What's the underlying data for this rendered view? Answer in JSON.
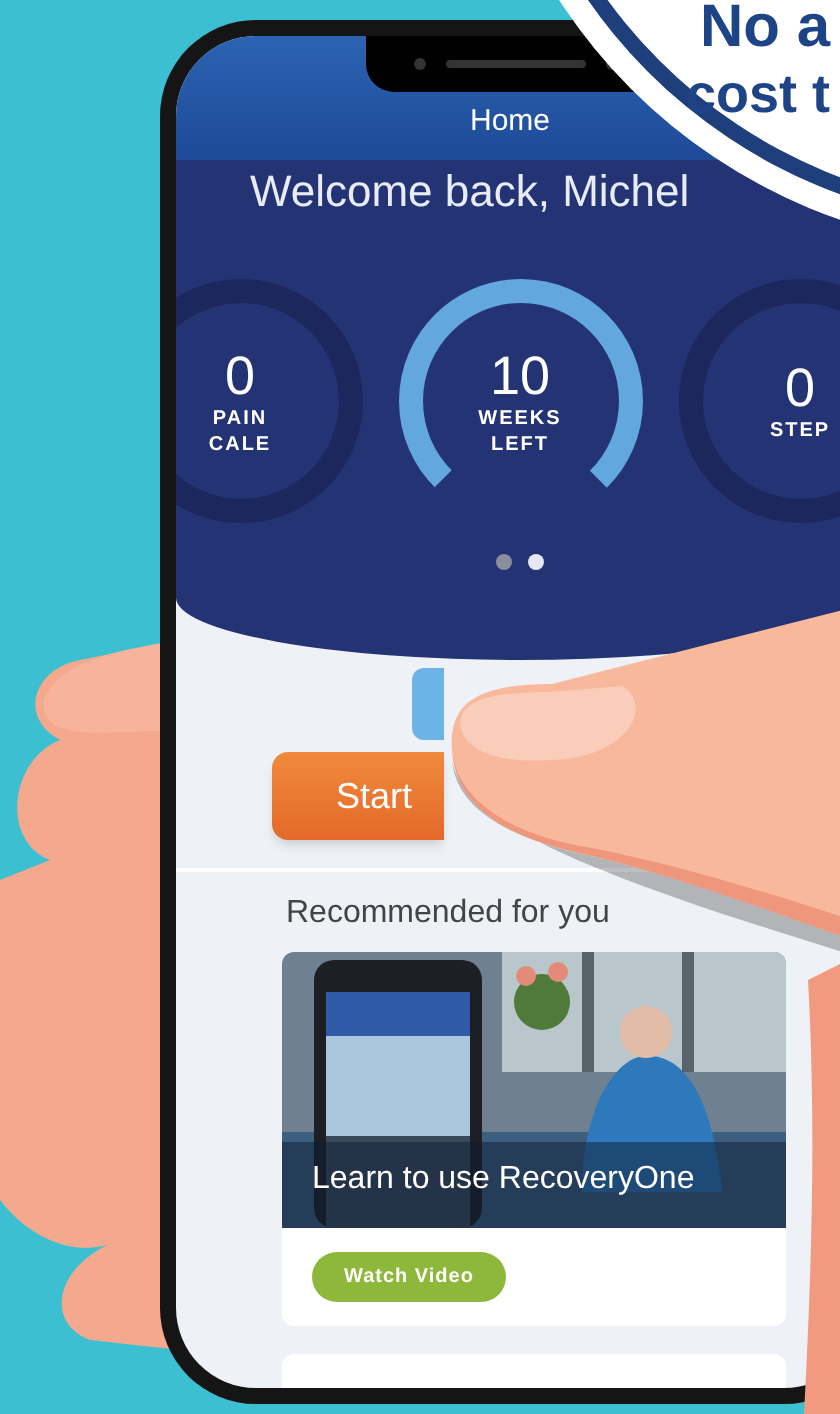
{
  "header": {
    "title": "Home"
  },
  "welcome": "Welcome back, Michel",
  "stats": [
    {
      "value": "0",
      "label_lines": [
        "PAIN",
        "CALE"
      ],
      "kind": "ring"
    },
    {
      "value": "10",
      "label_lines": [
        "WEEKS",
        "LEFT"
      ],
      "kind": "gauge"
    },
    {
      "value": "0",
      "label_lines": [
        "STEP"
      ],
      "kind": "ring"
    }
  ],
  "pages": [
    {
      "selected": false
    },
    {
      "selected": true
    }
  ],
  "start_button": "Start",
  "section_title": "Recommended for you",
  "card": {
    "title": "Learn to use RecoveryOne",
    "button": "Watch Video"
  },
  "badge": {
    "lines": [
      "No a",
      "cost t"
    ]
  }
}
